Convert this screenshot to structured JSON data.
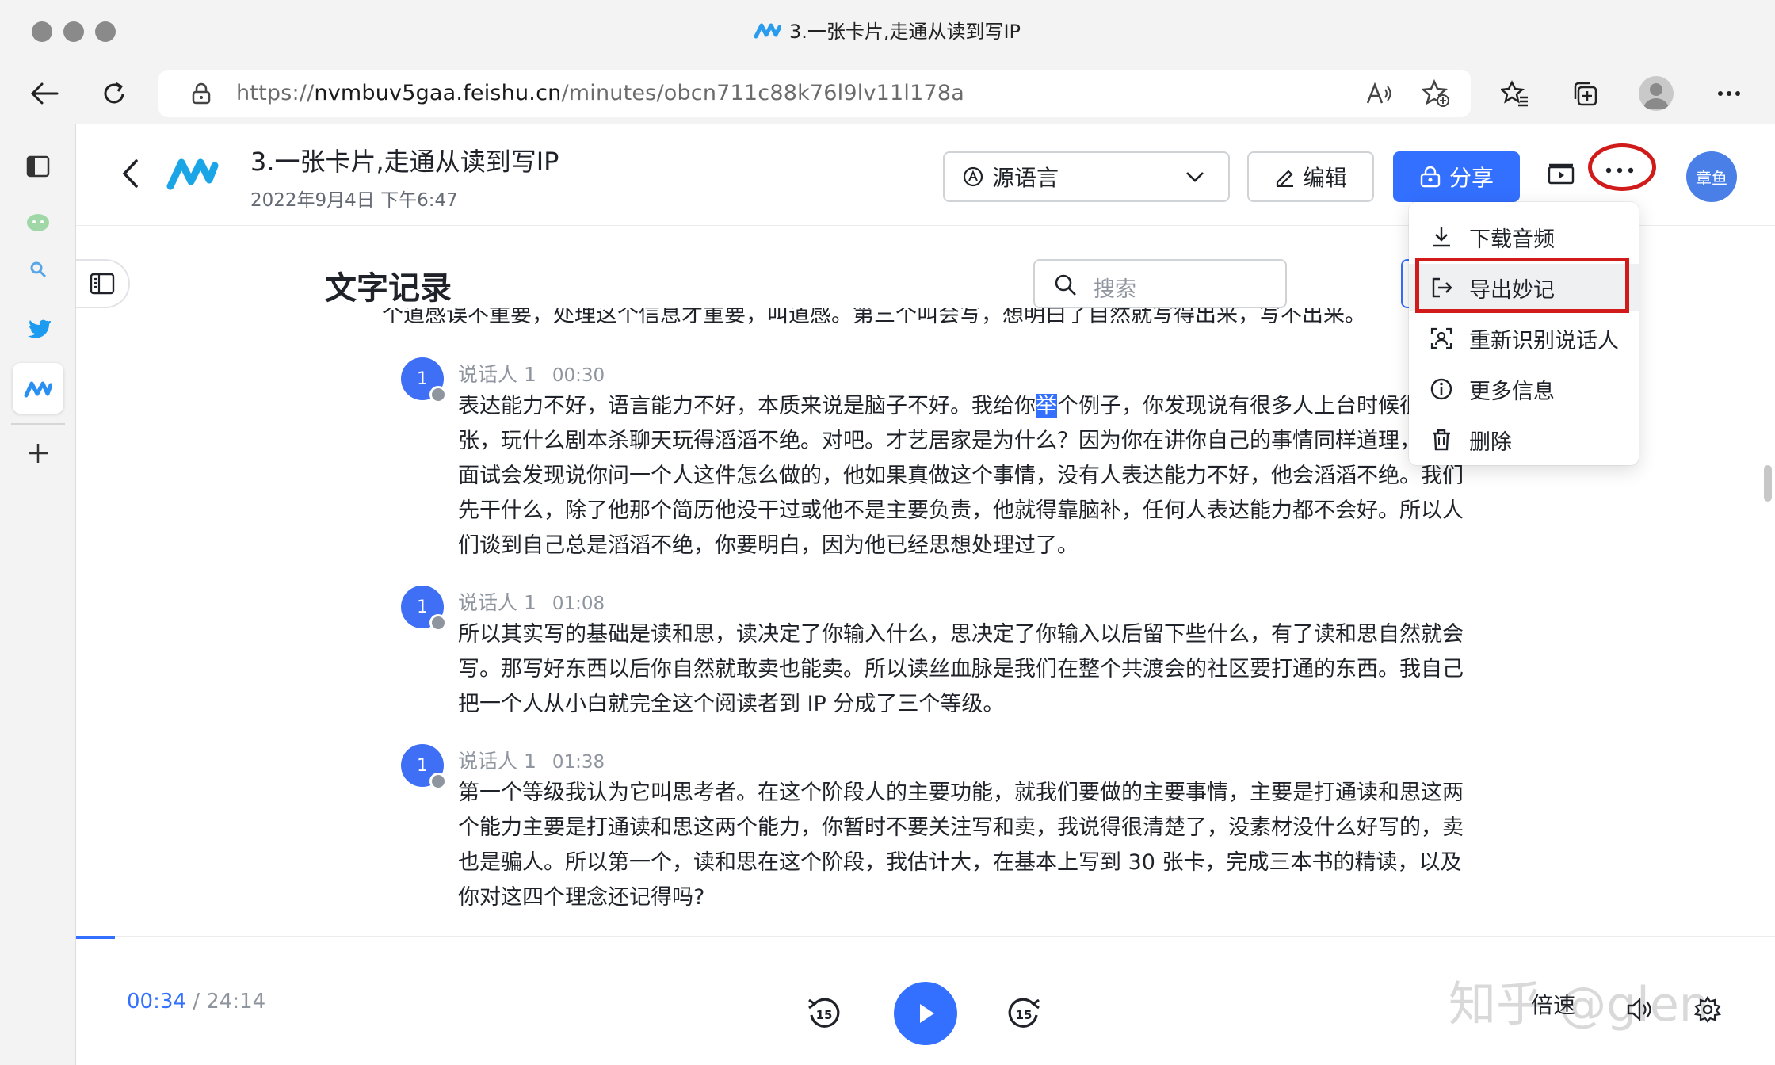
{
  "browser": {
    "window_title": "3.一张卡片,走通从读到写IP",
    "url_prefix": "https://",
    "url_host": "nvmbuv5gaa.feishu.cn",
    "url_path": "/minutes/obcn711c88k76l9lv11l178a"
  },
  "header": {
    "title": "3.一张卡片,走通从读到写IP",
    "date": "2022年9月4日 下午6:47",
    "language_select": "源语言",
    "edit_label": "编辑",
    "share_label": "分享",
    "user_avatar": "章鱼"
  },
  "transcript": {
    "section_title": "文字记录",
    "search_placeholder": "搜索",
    "clipped_line": "个道感误不重要，处理这个信息才重要，叫道感。第三个叫会写，想明白了自然就写得出来，写不出来。",
    "paragraphs": [
      {
        "avatar": "1",
        "speaker": "说话人 1",
        "timestamp": "00:30",
        "text_before": "表达能力不好，语言能力不好，本质来说是脑子不好。我给你",
        "highlight": "举",
        "text_after": "个例子，你发现说有很多人上台时候很紧张，玩什么剧本杀聊天玩得滔滔不绝。对吧。才艺居家是为什么？因为你在讲你自己的事情同样道理，你去面试会发现说你问一个人这件怎么做的，他如果真做这个事情，没有人表达能力不好，他会滔滔不绝。我们先干什么，除了他那个简历他没干过或他不是主要负责，他就得靠脑补，任何人表达能力都不会好。所以人们谈到自己总是滔滔不绝，你要明白，因为他已经思想处理过了。"
      },
      {
        "avatar": "1",
        "speaker": "说话人 1",
        "timestamp": "01:08",
        "text": "所以其实写的基础是读和思，读决定了你输入什么，思决定了你输入以后留下些什么，有了读和思自然就会写。那写好东西以后你自然就敢卖也能卖。所以读丝血脉是我们在整个共渡会的社区要打通的东西。我自己把一个人从小白就完全这个阅读者到 IP 分成了三个等级。"
      },
      {
        "avatar": "1",
        "speaker": "说话人 1",
        "timestamp": "01:38",
        "text": "第一个等级我认为它叫思考者。在这个阶段人的主要功能，就我们要做的主要事情，主要是打通读和思这两个能力主要是打通读和思这两个能力，你暂时不要关注写和卖，我说得很清楚了，没素材没什么好写的，卖也是骗人。所以第一个，读和思在这个阶段，我估计大，在基本上写到 30 张卡，完成三本书的精读，以及你对这四个理念还记得吗?"
      }
    ]
  },
  "more_menu": {
    "items": [
      {
        "label": "下载音频",
        "icon": "download-icon"
      },
      {
        "label": "导出妙记",
        "icon": "export-icon"
      },
      {
        "label": "重新识别说话人",
        "icon": "speaker-recognize-icon"
      },
      {
        "label": "更多信息",
        "icon": "info-icon"
      },
      {
        "label": "删除",
        "icon": "trash-icon"
      }
    ],
    "highlighted_index": 1
  },
  "player": {
    "current_time": "00:34",
    "separator": " / ",
    "total_time": "24:14",
    "rewind_seconds": "15",
    "forward_seconds": "15",
    "speed_label": "倍速",
    "progress_fraction": 0.023
  },
  "watermark": "知乎 @glen",
  "colors": {
    "accent": "#3370ff",
    "annotation_red": "#d11b1b"
  }
}
